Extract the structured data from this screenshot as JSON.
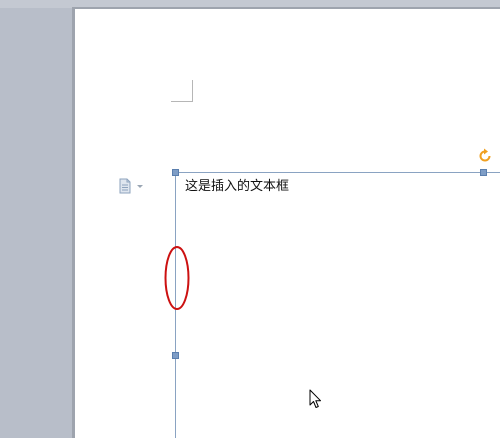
{
  "document": {
    "textbox_text": "这是插入的文本框"
  },
  "icons": {
    "paragraph_options": "document-icon",
    "rotate_handle": "rotate-icon",
    "cursor": "mouse-pointer-icon"
  },
  "colors": {
    "workspace": "#b8bec9",
    "page": "#ffffff",
    "textbox_border": "#8aa3c2",
    "handle": "#7e9dc6",
    "rotate_handle": "#f0a020",
    "annotation": "#cc1111"
  }
}
